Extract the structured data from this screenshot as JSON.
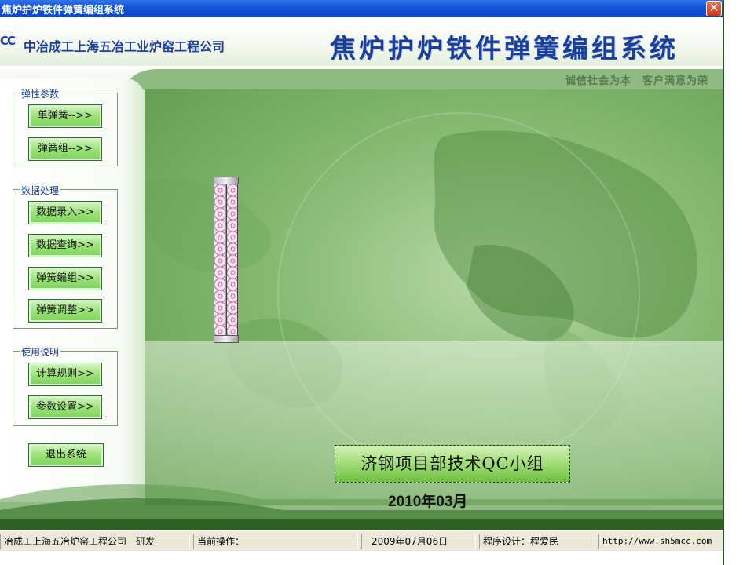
{
  "window": {
    "title": "焦炉护炉铁件弹簧编组系统",
    "close_glyph": "✕"
  },
  "header": {
    "logo_text": "CC",
    "company": "中冶成工上海五冶工业炉窑工程公司",
    "system_title": "焦炉护炉铁件弹簧编组系统",
    "slogan": "诚信社会为本　客户满意为荣"
  },
  "sidebar": {
    "groups": [
      {
        "legend": "弹性参数",
        "buttons": [
          "单弹簧-->>",
          "弹簧组-->>"
        ]
      },
      {
        "legend": "数据处理",
        "buttons": [
          "数据录入>>",
          "数据查询>>",
          "弹簧编组>>",
          "弹簧调整>>"
        ]
      },
      {
        "legend": "使用说明",
        "buttons": [
          "计算规则>>",
          "参数设置>>"
        ]
      }
    ],
    "exit_label": "退出系统"
  },
  "main": {
    "caption": "济钢项目部技术QC小组",
    "date": "2010年03月"
  },
  "statusbar": {
    "company": "冶成工上海五冶炉窑工程公司　研发",
    "operation": "当前操作：",
    "date": "2009年07月06日",
    "designer": "程序设计：程爱民",
    "url": "http://www.sh5mcc.com"
  },
  "colors": {
    "titlebar": "#1254d6",
    "brand_blue": "#1d3f95",
    "button_green": "#9be27a",
    "main_green": "#86ba72"
  }
}
